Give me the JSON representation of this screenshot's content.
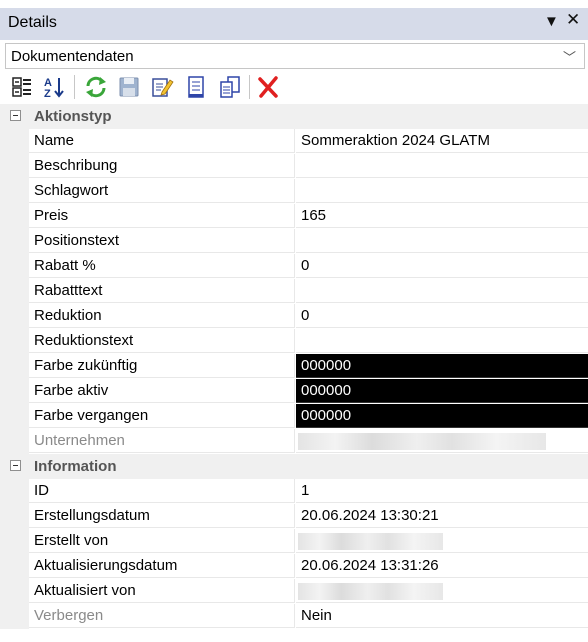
{
  "window": {
    "title": "Details"
  },
  "selector": {
    "value": "Dokumentendaten"
  },
  "toolbar": {
    "icons": [
      "categorized-view-icon",
      "alphabetical-sort-icon",
      "refresh-icon",
      "save-icon",
      "edit-icon",
      "document-icon",
      "copy-icon",
      "delete-icon"
    ]
  },
  "categories": [
    {
      "title": "Aktionstyp",
      "rows": [
        {
          "label": "Name",
          "value": "Sommeraktion  2024 GLATM"
        },
        {
          "label": "Beschribung",
          "value": ""
        },
        {
          "label": "Schlagwort",
          "value": ""
        },
        {
          "label": "Preis",
          "value": "165"
        },
        {
          "label": "Positionstext",
          "value": ""
        },
        {
          "label": "Rabatt %",
          "value": "0"
        },
        {
          "label": "Rabatttext",
          "value": ""
        },
        {
          "label": "Reduktion",
          "value": "0"
        },
        {
          "label": "Reduktionstext",
          "value": ""
        },
        {
          "label": "Farbe zukünftig",
          "value": "000000"
        },
        {
          "label": "Farbe aktiv",
          "value": "000000"
        },
        {
          "label": "Farbe vergangen",
          "value": "000000"
        },
        {
          "label": "Unternehmen",
          "value": ""
        }
      ]
    },
    {
      "title": "Information",
      "rows": [
        {
          "label": "ID",
          "value": "1"
        },
        {
          "label": "Erstellungsdatum",
          "value": "20.06.2024 13:30:21"
        },
        {
          "label": "Erstellt von",
          "value": ""
        },
        {
          "label": "Aktualisierungsdatum",
          "value": "20.06.2024 13:31:26"
        },
        {
          "label": "Aktualisiert von",
          "value": ""
        },
        {
          "label": "Verbergen",
          "value": "Nein"
        }
      ]
    }
  ],
  "colors": {
    "color_swatch": "#000000",
    "title_bar": "#d6dbe9"
  }
}
